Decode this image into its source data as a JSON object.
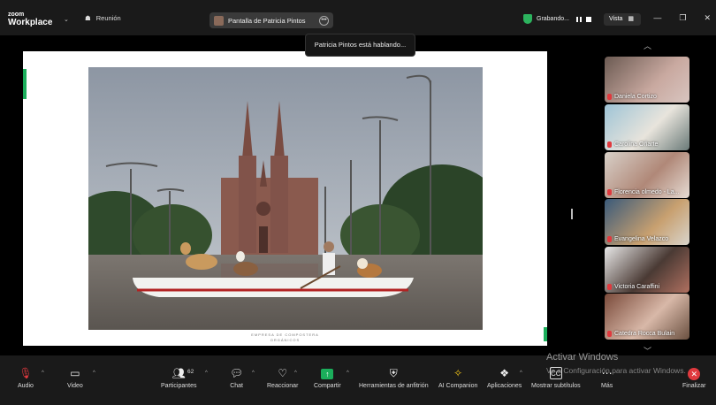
{
  "app": {
    "brand_top": "zoom",
    "brand_bottom": "Workplace"
  },
  "topbar": {
    "meeting_label": "Reunión",
    "share_label": "Pantalla de Patricia Pintos",
    "recording_label": "Grabando...",
    "view_label": "Vista"
  },
  "tooltip": "Patricia Pintos está hablando...",
  "slide": {
    "caption_line1": "EMPRESA DE COMPOSTERA",
    "caption_line2": "ORGÁNICOS"
  },
  "participants": [
    {
      "name": "Daniela Cortizo",
      "muted": true
    },
    {
      "name": "Carolina Oñarte",
      "muted": true
    },
    {
      "name": "Florencia olmedo - La...",
      "muted": true
    },
    {
      "name": "Evangelina Velazco",
      "muted": true
    },
    {
      "name": "Victoria Caraffini",
      "muted": true
    },
    {
      "name": "Catedra Rocca Bulain",
      "muted": true
    }
  ],
  "toolbar": {
    "audio": "Audio",
    "video": "Video",
    "participants": "Participantes",
    "participant_count": "62",
    "chat": "Chat",
    "react": "Reaccionar",
    "share": "Compartir",
    "host_tools": "Herramientas de anfitrión",
    "ai_companion": "AI Companion",
    "apps": "Aplicaciones",
    "captions": "Mostrar subtítulos",
    "more": "Más",
    "end": "Finalizar"
  },
  "watermark": {
    "title": "Activar Windows",
    "subtitle": "Ve a Configuración para activar Windows."
  },
  "colors": {
    "accent_green": "#1bae5b",
    "end_red": "#e0393e",
    "bar_bg": "#1a1a1a"
  }
}
